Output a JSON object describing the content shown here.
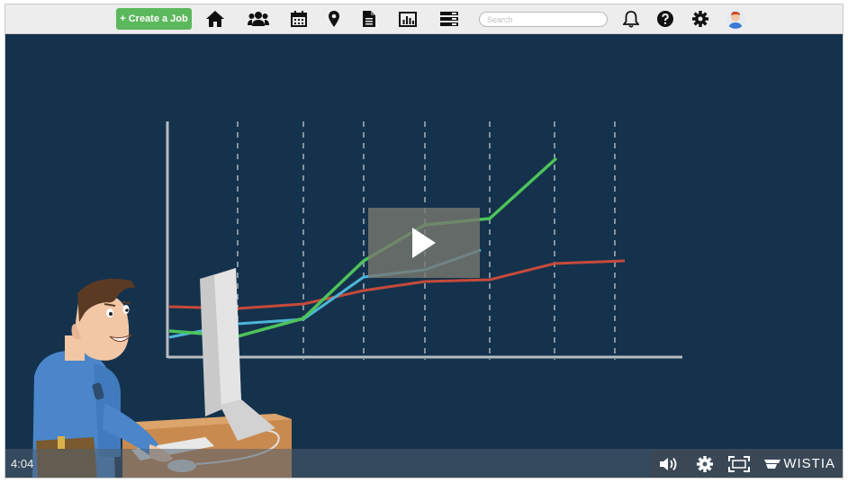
{
  "topbar": {
    "create_job_label": "+ Create a Job",
    "search_placeholder": "Search",
    "icons": [
      "home-icon",
      "team-icon",
      "calendar-icon",
      "map-marker-icon",
      "document-icon",
      "bar-chart-icon",
      "list-icon",
      "bell-icon",
      "help-icon",
      "gear-icon",
      "user-avatar"
    ]
  },
  "video": {
    "time": "4:04",
    "brand": "WISTIA",
    "colors": {
      "background": "#15324c",
      "green_line": "#4dc35a",
      "red_line": "#c64a3b",
      "blue_line": "#4cb6d8",
      "create_button": "#5cb85c"
    }
  }
}
